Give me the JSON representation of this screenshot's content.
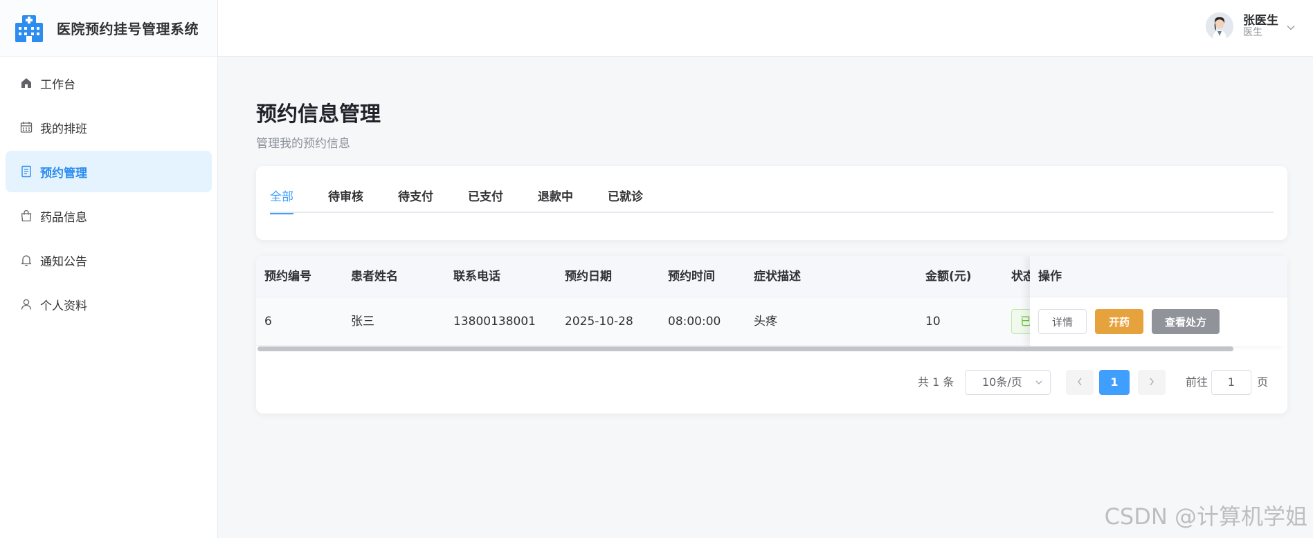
{
  "app": {
    "title": "医院预约挂号管理系统"
  },
  "sidebar": {
    "items": [
      {
        "label": "工作台",
        "icon": "home-icon"
      },
      {
        "label": "我的排班",
        "icon": "calendar-icon"
      },
      {
        "label": "预约管理",
        "icon": "document-icon",
        "active": true
      },
      {
        "label": "药品信息",
        "icon": "bag-icon"
      },
      {
        "label": "通知公告",
        "icon": "bell-icon"
      },
      {
        "label": "个人资料",
        "icon": "user-icon"
      }
    ]
  },
  "header": {
    "user": {
      "name": "张医生",
      "role": "医生"
    }
  },
  "page": {
    "title": "预约信息管理",
    "subtitle": "管理我的预约信息"
  },
  "tabs": [
    {
      "label": "全部",
      "active": true
    },
    {
      "label": "待审核"
    },
    {
      "label": "待支付"
    },
    {
      "label": "已支付"
    },
    {
      "label": "退款中"
    },
    {
      "label": "已就诊"
    }
  ],
  "table": {
    "columns": [
      "预约编号",
      "患者姓名",
      "联系电话",
      "预约日期",
      "预约时间",
      "症状描述",
      "金额(元)",
      "状态",
      "操作"
    ],
    "rows": [
      {
        "id": "6",
        "patient": "张三",
        "phone": "13800138001",
        "date": "2025-10-28",
        "time": "08:00:00",
        "symptom": "头疼",
        "amount": "10",
        "status": "已"
      }
    ],
    "actions": {
      "detail": "详情",
      "prescribe": "开药",
      "view_prescription": "查看处方"
    }
  },
  "pagination": {
    "total": "共 1 条",
    "page_size": "10条/页",
    "current": "1",
    "goto_label": "前往",
    "goto_value": "1",
    "page_label": "页"
  },
  "colors": {
    "primary": "#409eff",
    "warning": "#e6a23c",
    "info": "#909399",
    "success": "#67c23a"
  },
  "watermark": "CSDN @计算机学姐"
}
